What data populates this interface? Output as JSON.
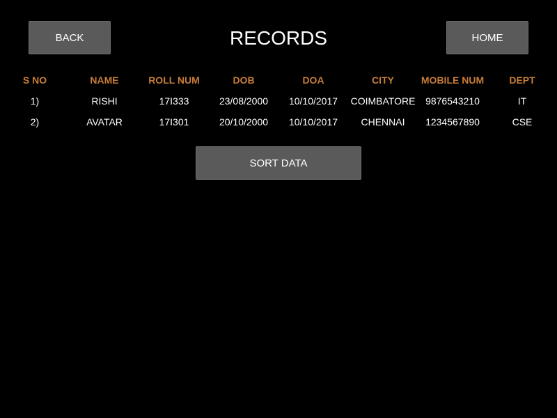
{
  "header": {
    "back_label": "BACK",
    "title": "RECORDS",
    "home_label": "HOME"
  },
  "table": {
    "columns": [
      "S NO",
      "NAME",
      "ROLL NUM",
      "DOB",
      "DOA",
      "CITY",
      "MOBILE NUM",
      "DEPT"
    ],
    "rows": [
      [
        "1)",
        "RISHI",
        "17I333",
        "23/08/2000",
        "10/10/2017",
        "COIMBATORE",
        "9876543210",
        "IT"
      ],
      [
        "2)",
        "AVATAR",
        "17I301",
        "20/10/2000",
        "10/10/2017",
        "CHENNAI",
        "1234567890",
        "CSE"
      ]
    ]
  },
  "actions": {
    "sort_label": "SORT DATA"
  },
  "colors": {
    "background": "#000000",
    "button": "#5a5a5a",
    "header_text": "#c77d3a",
    "text": "#ffffff"
  }
}
